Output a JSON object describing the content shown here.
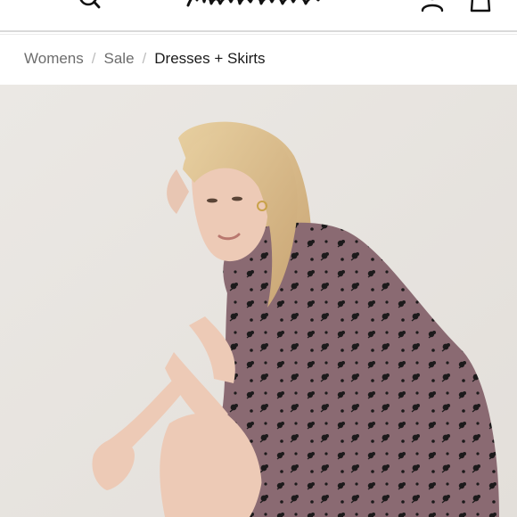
{
  "header": {
    "logo_text": "Madewell",
    "icons": {
      "menu": "hamburger-menu-icon",
      "search": "search-icon",
      "account": "account-icon",
      "bag": "shopping-bag-icon"
    }
  },
  "breadcrumb": {
    "items": [
      {
        "label": "Womens"
      },
      {
        "label": "Sale"
      },
      {
        "label": "Dresses + Skirts"
      }
    ],
    "separator": "/"
  },
  "product_image": {
    "background_color": "#e9e6e2",
    "dress_color": "#8a6a72"
  }
}
